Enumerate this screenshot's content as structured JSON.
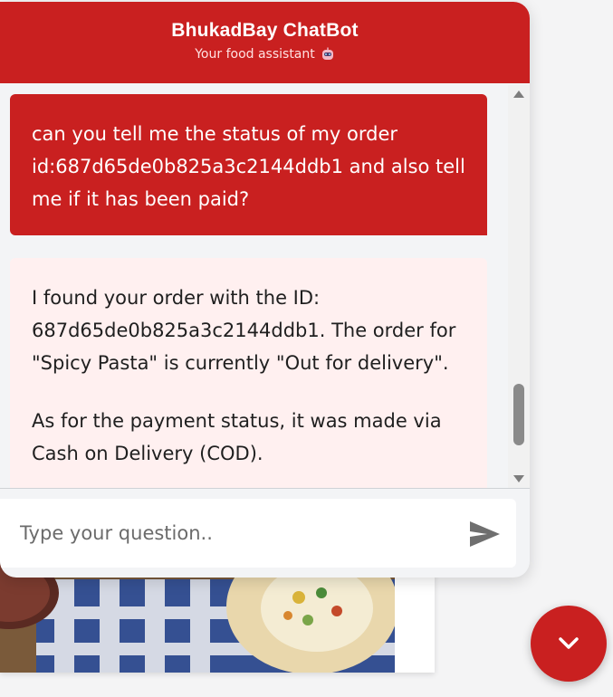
{
  "header": {
    "title": "BhukadBay ChatBot",
    "subtitle": "Your food assistant"
  },
  "messages": [
    {
      "role": "user",
      "text": "can you tell me the status of my order id:687d65de0b825a3c2144ddb1 and also tell me if it has been paid?"
    },
    {
      "role": "bot",
      "paragraphs": [
        "I found your order with the ID: 687d65de0b825a3c2144ddb1. The order for \"Spicy Pasta\" is currently \"Out for delivery\".",
        "As for the payment status, it was made via Cash on Delivery (COD)."
      ]
    }
  ],
  "input": {
    "placeholder": "Type your question..",
    "value": ""
  },
  "icons": {
    "bot": "robot-icon",
    "send": "send-icon",
    "toggle": "chevron-down-icon"
  },
  "colors": {
    "brand": "#c92020",
    "bot_bubble": "#fff0f0"
  }
}
